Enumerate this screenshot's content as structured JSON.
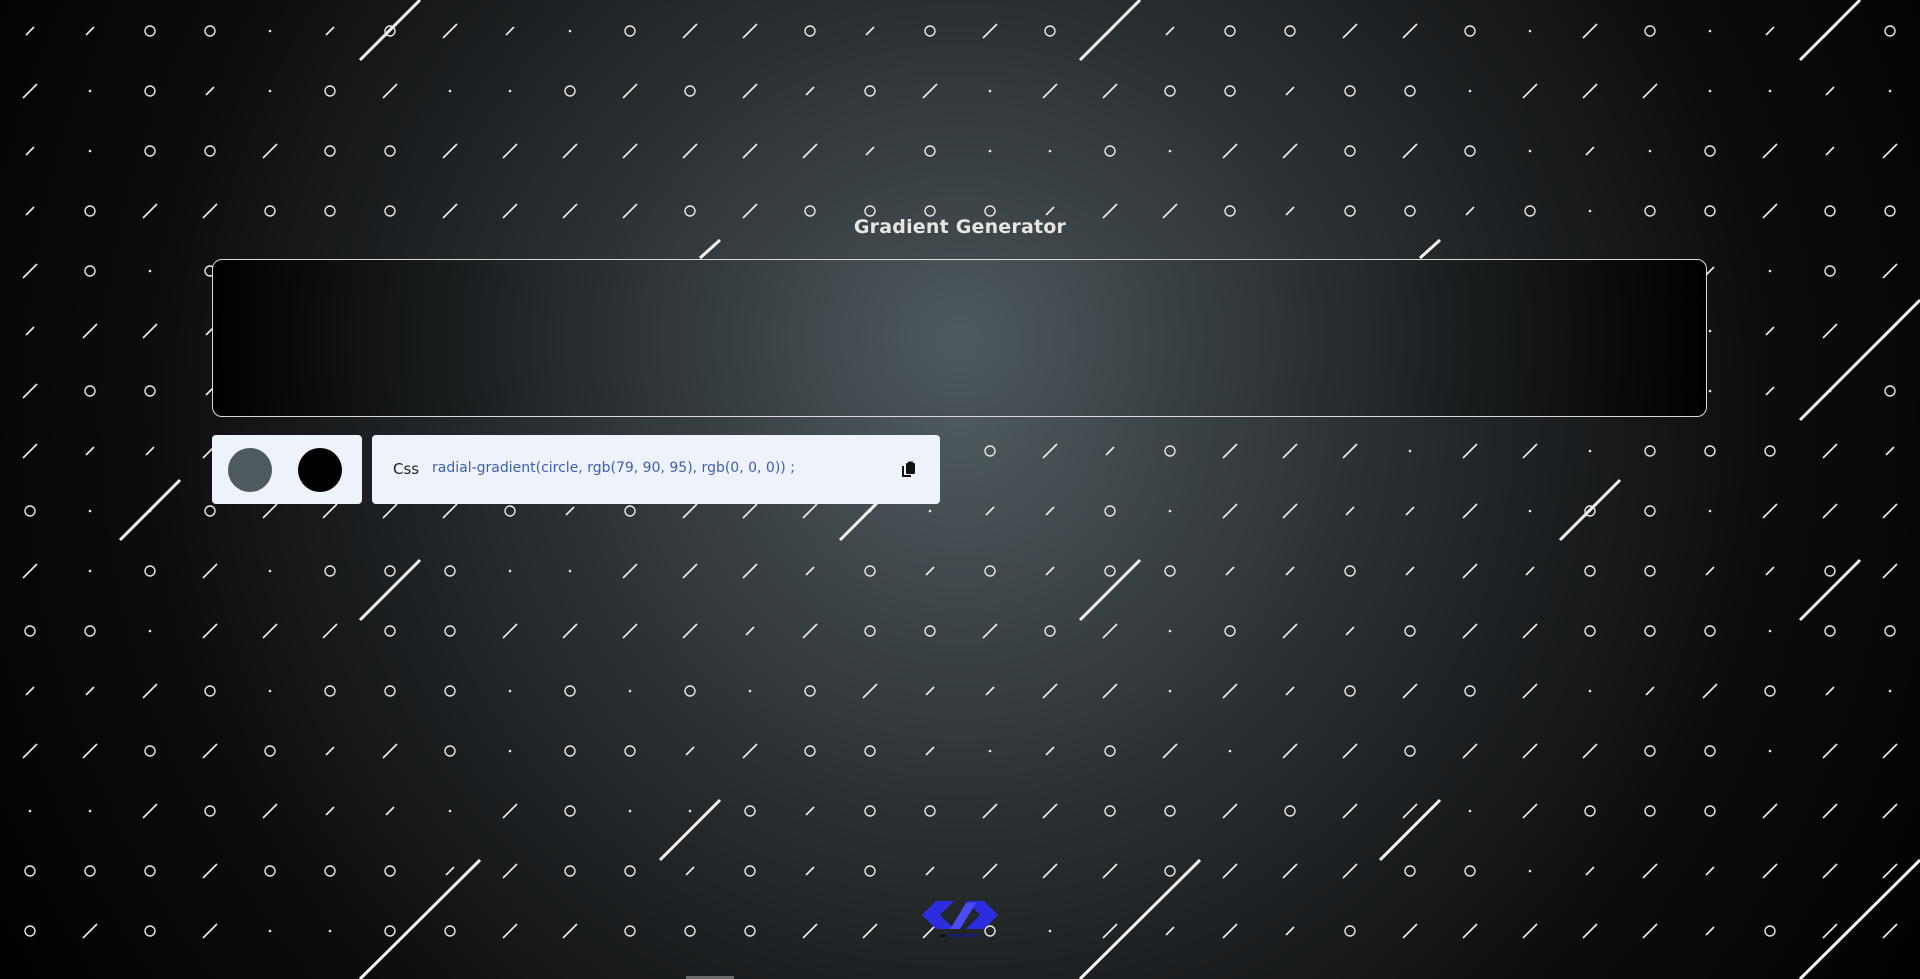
{
  "page": {
    "title": "Gradient Generator"
  },
  "gradient": {
    "css_label": "Css",
    "css_value": "radial-gradient(circle, rgb(79, 90, 95), rgb(0, 0, 0)) ;",
    "color_stops": [
      "#4f5a5f",
      "#000000"
    ]
  },
  "icons": {
    "copy": "copy-icon",
    "logo": "brand-logo-icon"
  },
  "colors": {
    "panel_bg": "#eef3fb",
    "code_text": "#3e5fb0",
    "logo_blue": "#2b2ee0"
  }
}
